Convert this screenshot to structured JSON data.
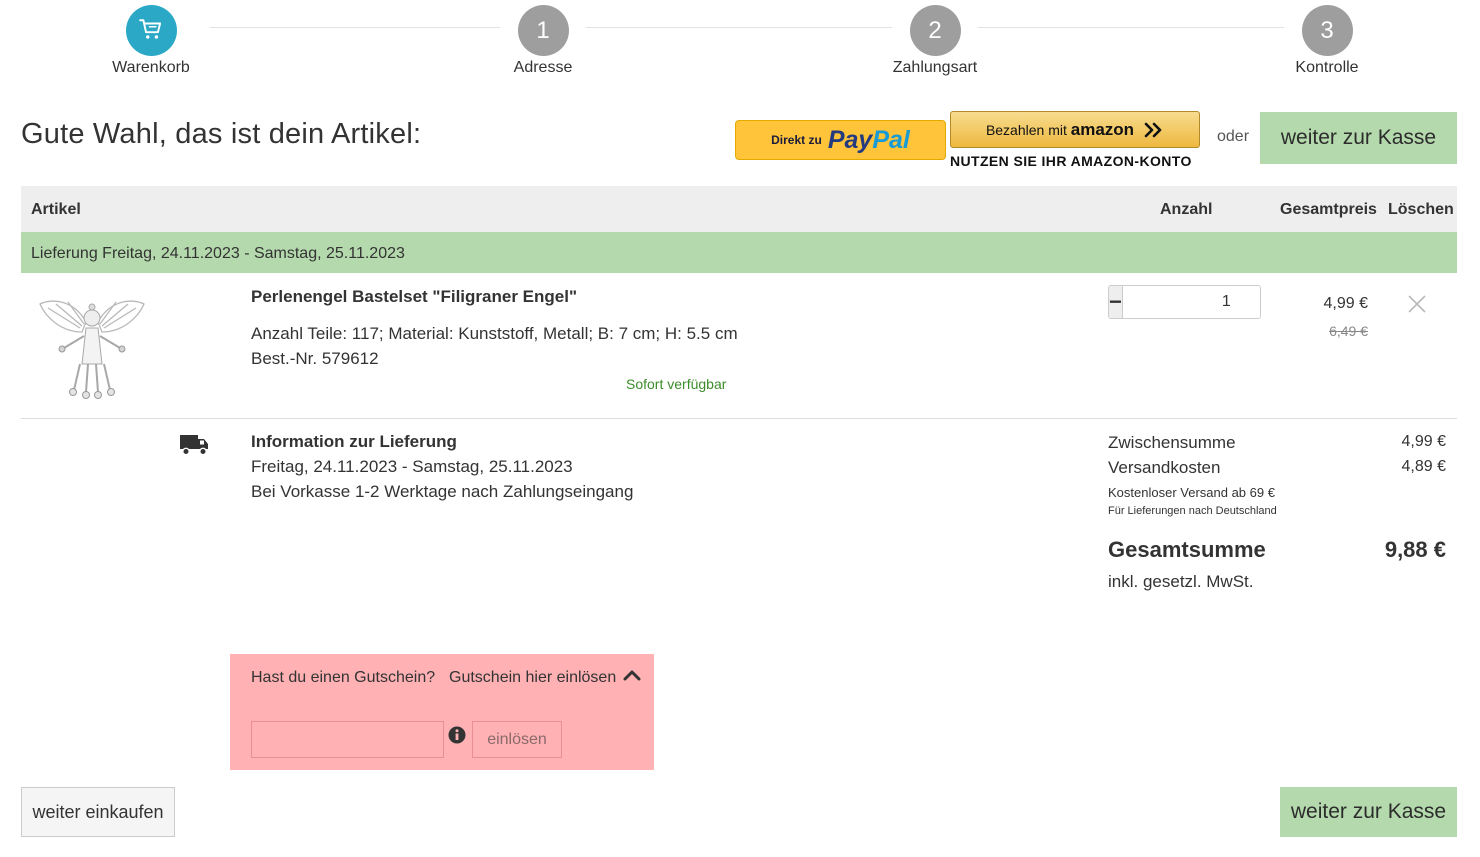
{
  "stepper": {
    "steps": [
      {
        "label": "Warenkorb",
        "number": "",
        "icon": "cart-icon",
        "active": true
      },
      {
        "label": "Adresse",
        "number": "1",
        "active": false
      },
      {
        "label": "Zahlungsart",
        "number": "2",
        "active": false
      },
      {
        "label": "Kontrolle",
        "number": "3",
        "active": false
      }
    ],
    "colors": {
      "active": "#2aa8c6",
      "inactive": "#9e9e9e"
    }
  },
  "header": {
    "title": "Gute Wahl, das ist dein Artikel:",
    "paypal": {
      "prefix": "Direkt zu",
      "brand_pay": "Pay",
      "brand_pal": "Pal"
    },
    "amazon": {
      "prefix": "Bezahlen mit",
      "brand": "amazon",
      "note": "NUTZEN SIE IHR AMAZON-KONTO"
    },
    "oder": "oder",
    "checkout_label": "weiter zur Kasse"
  },
  "table": {
    "columns": {
      "article": "Artikel",
      "quantity": "Anzahl",
      "total": "Gesamtpreis",
      "delete": "Löschen"
    },
    "delivery_bar": "Lieferung Freitag, 24.11.2023 - Samstag, 25.11.2023"
  },
  "product": {
    "name": "Perlenengel Bastelset \"Filigraner Engel\"",
    "attributes": "Anzahl Teile: 117; Material: Kunststoff, Metall; B: 7 cm; H: 5.5 cm",
    "sku": "Best.-Nr. 579612",
    "availability": "Sofort verfügbar",
    "quantity": "1",
    "minus": "−",
    "plus": "+",
    "price": "4,99 €",
    "old_price": "6,49 €"
  },
  "delivery_info": {
    "title": "Information zur Lieferung",
    "date": "Freitag, 24.11.2023 - Samstag, 25.11.2023",
    "note": "Bei Vorkasse 1-2 Werktage nach Zahlungseingang"
  },
  "summary": {
    "subtotal_label": "Zwischensumme",
    "subtotal_value": "4,99 €",
    "shipping_label": "Versandkosten",
    "shipping_value": "4,89 €",
    "free_shipping": "Kostenloser Versand ab 69 €",
    "region_note": "Für Lieferungen nach Deutschland",
    "total_label": "Gesamtsumme",
    "total_value": "9,88 €",
    "vat_note": "inkl. gesetzl. MwSt."
  },
  "coupon": {
    "question": "Hast du einen Gutschein?",
    "link": "Gutschein hier einlösen",
    "input_value": "",
    "redeem_label": "einlösen"
  },
  "footer": {
    "continue_label": "weiter einkaufen",
    "checkout_label": "weiter zur Kasse"
  }
}
